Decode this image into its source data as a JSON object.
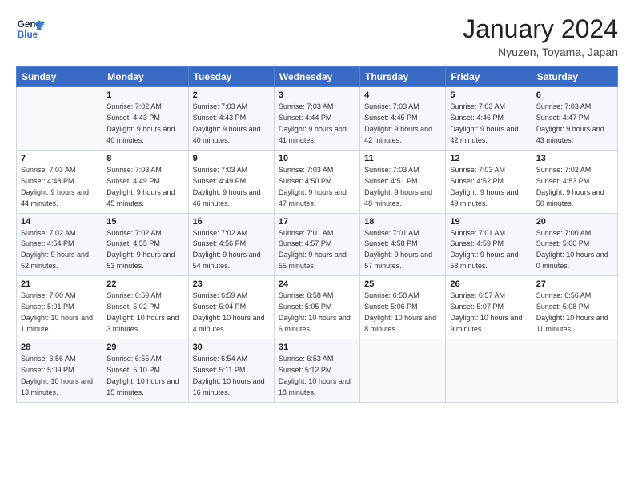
{
  "logo": {
    "line1": "General",
    "line2": "Blue"
  },
  "header": {
    "title": "January 2024",
    "subtitle": "Nyuzen, Toyama, Japan"
  },
  "weekdays": [
    "Sunday",
    "Monday",
    "Tuesday",
    "Wednesday",
    "Thursday",
    "Friday",
    "Saturday"
  ],
  "weeks": [
    [
      {
        "day": "",
        "sunrise": "",
        "sunset": "",
        "daylight": ""
      },
      {
        "day": "1",
        "sunrise": "Sunrise: 7:02 AM",
        "sunset": "Sunset: 4:43 PM",
        "daylight": "Daylight: 9 hours and 40 minutes."
      },
      {
        "day": "2",
        "sunrise": "Sunrise: 7:03 AM",
        "sunset": "Sunset: 4:43 PM",
        "daylight": "Daylight: 9 hours and 40 minutes."
      },
      {
        "day": "3",
        "sunrise": "Sunrise: 7:03 AM",
        "sunset": "Sunset: 4:44 PM",
        "daylight": "Daylight: 9 hours and 41 minutes."
      },
      {
        "day": "4",
        "sunrise": "Sunrise: 7:03 AM",
        "sunset": "Sunset: 4:45 PM",
        "daylight": "Daylight: 9 hours and 42 minutes."
      },
      {
        "day": "5",
        "sunrise": "Sunrise: 7:03 AM",
        "sunset": "Sunset: 4:46 PM",
        "daylight": "Daylight: 9 hours and 42 minutes."
      },
      {
        "day": "6",
        "sunrise": "Sunrise: 7:03 AM",
        "sunset": "Sunset: 4:47 PM",
        "daylight": "Daylight: 9 hours and 43 minutes."
      }
    ],
    [
      {
        "day": "7",
        "sunrise": "Sunrise: 7:03 AM",
        "sunset": "Sunset: 4:48 PM",
        "daylight": "Daylight: 9 hours and 44 minutes."
      },
      {
        "day": "8",
        "sunrise": "Sunrise: 7:03 AM",
        "sunset": "Sunset: 4:49 PM",
        "daylight": "Daylight: 9 hours and 45 minutes."
      },
      {
        "day": "9",
        "sunrise": "Sunrise: 7:03 AM",
        "sunset": "Sunset: 4:49 PM",
        "daylight": "Daylight: 9 hours and 46 minutes."
      },
      {
        "day": "10",
        "sunrise": "Sunrise: 7:03 AM",
        "sunset": "Sunset: 4:50 PM",
        "daylight": "Daylight: 9 hours and 47 minutes."
      },
      {
        "day": "11",
        "sunrise": "Sunrise: 7:03 AM",
        "sunset": "Sunset: 4:51 PM",
        "daylight": "Daylight: 9 hours and 48 minutes."
      },
      {
        "day": "12",
        "sunrise": "Sunrise: 7:03 AM",
        "sunset": "Sunset: 4:52 PM",
        "daylight": "Daylight: 9 hours and 49 minutes."
      },
      {
        "day": "13",
        "sunrise": "Sunrise: 7:02 AM",
        "sunset": "Sunset: 4:53 PM",
        "daylight": "Daylight: 9 hours and 50 minutes."
      }
    ],
    [
      {
        "day": "14",
        "sunrise": "Sunrise: 7:02 AM",
        "sunset": "Sunset: 4:54 PM",
        "daylight": "Daylight: 9 hours and 52 minutes."
      },
      {
        "day": "15",
        "sunrise": "Sunrise: 7:02 AM",
        "sunset": "Sunset: 4:55 PM",
        "daylight": "Daylight: 9 hours and 53 minutes."
      },
      {
        "day": "16",
        "sunrise": "Sunrise: 7:02 AM",
        "sunset": "Sunset: 4:56 PM",
        "daylight": "Daylight: 9 hours and 54 minutes."
      },
      {
        "day": "17",
        "sunrise": "Sunrise: 7:01 AM",
        "sunset": "Sunset: 4:57 PM",
        "daylight": "Daylight: 9 hours and 55 minutes."
      },
      {
        "day": "18",
        "sunrise": "Sunrise: 7:01 AM",
        "sunset": "Sunset: 4:58 PM",
        "daylight": "Daylight: 9 hours and 57 minutes."
      },
      {
        "day": "19",
        "sunrise": "Sunrise: 7:01 AM",
        "sunset": "Sunset: 4:59 PM",
        "daylight": "Daylight: 9 hours and 58 minutes."
      },
      {
        "day": "20",
        "sunrise": "Sunrise: 7:00 AM",
        "sunset": "Sunset: 5:00 PM",
        "daylight": "Daylight: 10 hours and 0 minutes."
      }
    ],
    [
      {
        "day": "21",
        "sunrise": "Sunrise: 7:00 AM",
        "sunset": "Sunset: 5:01 PM",
        "daylight": "Daylight: 10 hours and 1 minute."
      },
      {
        "day": "22",
        "sunrise": "Sunrise: 6:59 AM",
        "sunset": "Sunset: 5:02 PM",
        "daylight": "Daylight: 10 hours and 3 minutes."
      },
      {
        "day": "23",
        "sunrise": "Sunrise: 6:59 AM",
        "sunset": "Sunset: 5:04 PM",
        "daylight": "Daylight: 10 hours and 4 minutes."
      },
      {
        "day": "24",
        "sunrise": "Sunrise: 6:58 AM",
        "sunset": "Sunset: 5:05 PM",
        "daylight": "Daylight: 10 hours and 6 minutes."
      },
      {
        "day": "25",
        "sunrise": "Sunrise: 6:58 AM",
        "sunset": "Sunset: 5:06 PM",
        "daylight": "Daylight: 10 hours and 8 minutes."
      },
      {
        "day": "26",
        "sunrise": "Sunrise: 6:57 AM",
        "sunset": "Sunset: 5:07 PM",
        "daylight": "Daylight: 10 hours and 9 minutes."
      },
      {
        "day": "27",
        "sunrise": "Sunrise: 6:56 AM",
        "sunset": "Sunset: 5:08 PM",
        "daylight": "Daylight: 10 hours and 11 minutes."
      }
    ],
    [
      {
        "day": "28",
        "sunrise": "Sunrise: 6:56 AM",
        "sunset": "Sunset: 5:09 PM",
        "daylight": "Daylight: 10 hours and 13 minutes."
      },
      {
        "day": "29",
        "sunrise": "Sunrise: 6:55 AM",
        "sunset": "Sunset: 5:10 PM",
        "daylight": "Daylight: 10 hours and 15 minutes."
      },
      {
        "day": "30",
        "sunrise": "Sunrise: 6:54 AM",
        "sunset": "Sunset: 5:11 PM",
        "daylight": "Daylight: 10 hours and 16 minutes."
      },
      {
        "day": "31",
        "sunrise": "Sunrise: 6:53 AM",
        "sunset": "Sunset: 5:12 PM",
        "daylight": "Daylight: 10 hours and 18 minutes."
      },
      {
        "day": "",
        "sunrise": "",
        "sunset": "",
        "daylight": ""
      },
      {
        "day": "",
        "sunrise": "",
        "sunset": "",
        "daylight": ""
      },
      {
        "day": "",
        "sunrise": "",
        "sunset": "",
        "daylight": ""
      }
    ]
  ]
}
